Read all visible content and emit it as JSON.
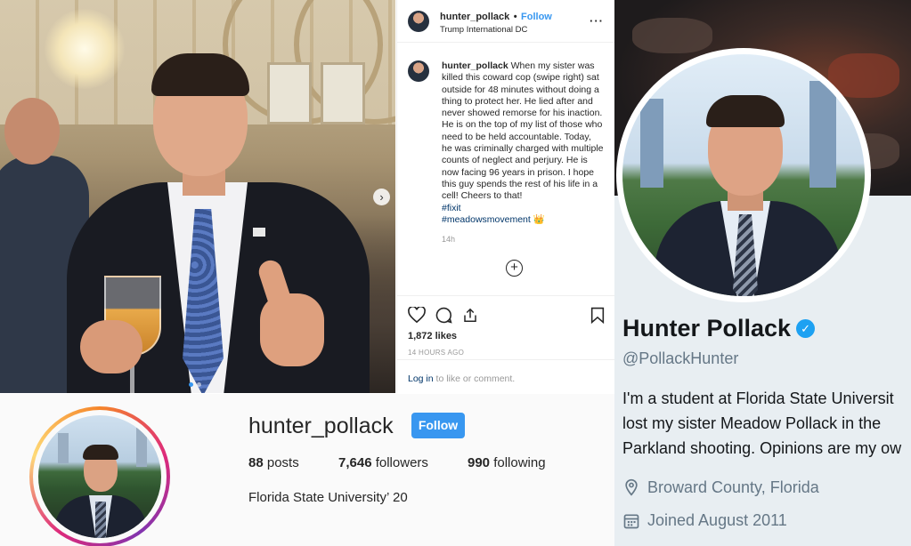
{
  "post": {
    "username": "hunter_pollack",
    "separator": "•",
    "follow_label": "Follow",
    "location": "Trump International DC",
    "more_icon": "more-horizontal-icon",
    "caption_username": "hunter_pollack",
    "caption_text": "When my sister was killed this coward cop (swipe right) sat outside for 48 minutes without doing a thing to protect her. He lied after and never showed remorse for his inaction. He is on the top of my list of those who need to be held accountable. Today, he was criminally charged with multiple counts of neglect and perjury. He is now facing 96 years in prison. I hope this guy spends the rest of his life in a cell! Cheers to that!",
    "hashtag_1": "#fixit",
    "hashtag_2": "#meadowsmovement 👑",
    "time_short": "14h",
    "likes": "1,872 likes",
    "posted_ago": "14 HOURS AGO",
    "login_link": "Log in",
    "login_rest": " to like or comment."
  },
  "profile": {
    "username": "hunter_pollack",
    "follow_button": "Follow",
    "posts_count": "88",
    "posts_label": " posts",
    "followers_count": "7,646",
    "followers_label": " followers",
    "following_count": "990",
    "following_label": " following",
    "bio": "Florida State University’ 20"
  },
  "twitter": {
    "display_name": "Hunter Pollack",
    "verified_icon": "verified-badge-icon",
    "handle": "@PollackHunter",
    "bio_line_1": "I'm a student at Florida State Universit",
    "bio_line_2": "lost my sister Meadow Pollack in the",
    "bio_line_3": "Parkland shooting. Opinions are my ow",
    "location": "Broward County, Florida",
    "joined": "Joined August 2011"
  },
  "colors": {
    "instagram_blue": "#3897f0",
    "twitter_blue": "#1da1f2",
    "muted": "#657786"
  }
}
